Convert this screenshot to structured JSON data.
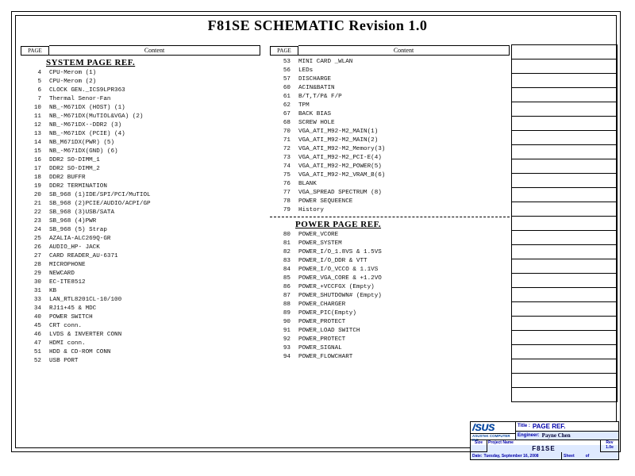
{
  "doc": {
    "title": "F81SE SCHEMATIC Revision 1.0"
  },
  "headers": {
    "page": "PAGE",
    "content": "Content"
  },
  "sections": {
    "system": "SYSTEM PAGE REF.",
    "power": "POWER PAGE REF."
  },
  "left_rows": [
    {
      "pg": "4",
      "txt": "CPU-Merom (1)"
    },
    {
      "pg": "5",
      "txt": "CPU-Merom (2)"
    },
    {
      "pg": "6",
      "txt": "CLOCK  GEN._ICS9LPR363"
    },
    {
      "pg": "7",
      "txt": "Thermal Senor-Fan"
    },
    {
      "pg": "10",
      "txt": "NB_-M671DX (HOST) (1)"
    },
    {
      "pg": "11",
      "txt": "NB_-M671DX(MuTIOL&VGA) (2)"
    },
    {
      "pg": "12",
      "txt": "NB_-M671DX--DDR2 (3)"
    },
    {
      "pg": "13",
      "txt": "NB_-M671DX (PCIE) (4)"
    },
    {
      "pg": "14",
      "txt": "NB_M671DX(PWR) (5)"
    },
    {
      "pg": "15",
      "txt": "NB_-M671DX(GND) (6)"
    },
    {
      "pg": "16",
      "txt": "DDR2 SO-DIMM_1"
    },
    {
      "pg": "17",
      "txt": "DDR2 SO-DIMM_2"
    },
    {
      "pg": "18",
      "txt": "DDR2 BUFFR"
    },
    {
      "pg": "19",
      "txt": "DDR2 TERMINATION"
    },
    {
      "pg": "20",
      "txt": "SB_968 (1)IDE/SPI/PCI/MuTIOL"
    },
    {
      "pg": "21",
      "txt": "SB_968 (2)PCIE/AUDIO/ACPI/GP"
    },
    {
      "pg": "22",
      "txt": "SB_968 (3)USB/SATA"
    },
    {
      "pg": "23",
      "txt": "SB_968 (4)PWR"
    },
    {
      "pg": "24",
      "txt": "SB_968 (5) Strap"
    },
    {
      "pg": "25",
      "txt": "AZALIA-ALC269Q-GR"
    },
    {
      "pg": "26",
      "txt": "AUDIO_HP- JACK"
    },
    {
      "pg": "27",
      "txt": "CARD READER_AU-6371"
    },
    {
      "pg": "28",
      "txt": "MICROPHONE"
    },
    {
      "pg": "29",
      "txt": "NEWCARD"
    },
    {
      "pg": "30",
      "txt": "EC-ITE8512"
    },
    {
      "pg": "31",
      "txt": "KB"
    },
    {
      "pg": "33",
      "txt": "LAN_RTL8201CL-10/100"
    },
    {
      "pg": "34",
      "txt": "RJ11+45 & MDC"
    },
    {
      "pg": "40",
      "txt": "POWER SWITCH"
    },
    {
      "pg": "45",
      "txt": "CRT conn."
    },
    {
      "pg": "46",
      "txt": "LVDS & INVERTER CONN"
    },
    {
      "pg": "47",
      "txt": "HDMI conn."
    },
    {
      "pg": "51",
      "txt": "HDD & CD-ROM CONN"
    },
    {
      "pg": "52",
      "txt": "USB PORT"
    }
  ],
  "right_rows_a": [
    {
      "pg": "53",
      "txt": "MINI CARD _WLAN"
    },
    {
      "pg": "56",
      "txt": "LEDs"
    },
    {
      "pg": "57",
      "txt": "DISCHARGE"
    },
    {
      "pg": "60",
      "txt": "ACIN&BATIN"
    },
    {
      "pg": "61",
      "txt": "B/T,T/P& F/P"
    },
    {
      "pg": "62",
      "txt": "TPM"
    },
    {
      "pg": "67",
      "txt": "BACK BIAS"
    },
    {
      "pg": "68",
      "txt": "SCREW HOLE"
    },
    {
      "pg": "70",
      "txt": "VGA_ATI_M92-M2_MAIN(1)"
    },
    {
      "pg": "71",
      "txt": "VGA_ATI_M92-M2_MAIN(2)"
    },
    {
      "pg": "72",
      "txt": "VGA_ATI_M92-M2_Memory(3)"
    },
    {
      "pg": "73",
      "txt": "VGA_ATI_M92-M2_PCI-E(4)"
    },
    {
      "pg": "74",
      "txt": "VGA_ATI_M92-M2_POWER(5)"
    },
    {
      "pg": "75",
      "txt": "VGA_ATI_M92-M2_VRAM_B(6)"
    },
    {
      "pg": "76",
      "txt": "BLANK"
    },
    {
      "pg": "77",
      "txt": "VGA_SPREAD SPECTRUM (8)"
    },
    {
      "pg": "78",
      "txt": "POWER SEQUEENCE"
    },
    {
      "pg": "79",
      "txt": "History"
    }
  ],
  "right_rows_b": [
    {
      "pg": "80",
      "txt": "POWER_VCORE"
    },
    {
      "pg": "81",
      "txt": "POWER_SYSTEM"
    },
    {
      "pg": "82",
      "txt": "POWER_I/O_1.8VS & 1.5VS"
    },
    {
      "pg": "83",
      "txt": "POWER_I/O_DDR & VTT"
    },
    {
      "pg": "84",
      "txt": "POWER_I/O_VCCO & 1.1VS"
    },
    {
      "pg": "85",
      "txt": "POWER_VGA_CORE & +1.2VO"
    },
    {
      "pg": "86",
      "txt": "POWER_+VCCFGX (Empty)"
    },
    {
      "pg": "87",
      "txt": "POWER_SHUTDOWN# (Empty)"
    },
    {
      "pg": "88",
      "txt": "POWER_CHARGER"
    },
    {
      "pg": "89",
      "txt": "POWER_PIC(Empty)"
    },
    {
      "pg": "90",
      "txt": "POWER_PROTECT"
    },
    {
      "pg": "91",
      "txt": "POWER_LOAD SWITCH"
    },
    {
      "pg": "92",
      "txt": "POWER_PROTECT"
    },
    {
      "pg": "93",
      "txt": "POWER_SIGNAL"
    },
    {
      "pg": "94",
      "txt": "POWER_FLOWCHART"
    }
  ],
  "right_table_rows": 25,
  "titleblock": {
    "company": "ASUSTeK COMPUTER INC",
    "title_label": "Title :",
    "title_value": "PAGE REF.",
    "engineer_label": "Engineer:",
    "engineer_value": "Payne Chen",
    "size_label": "Size",
    "size_value": "",
    "project_label": "Project Name",
    "project_value": "F81SE",
    "rev_label": "Rev",
    "rev_value": "1.0e",
    "date_label": "Date:",
    "date_value": "Tuesday, September 16, 2008",
    "sheet_label": "Sheet",
    "sheet_of": "of"
  }
}
